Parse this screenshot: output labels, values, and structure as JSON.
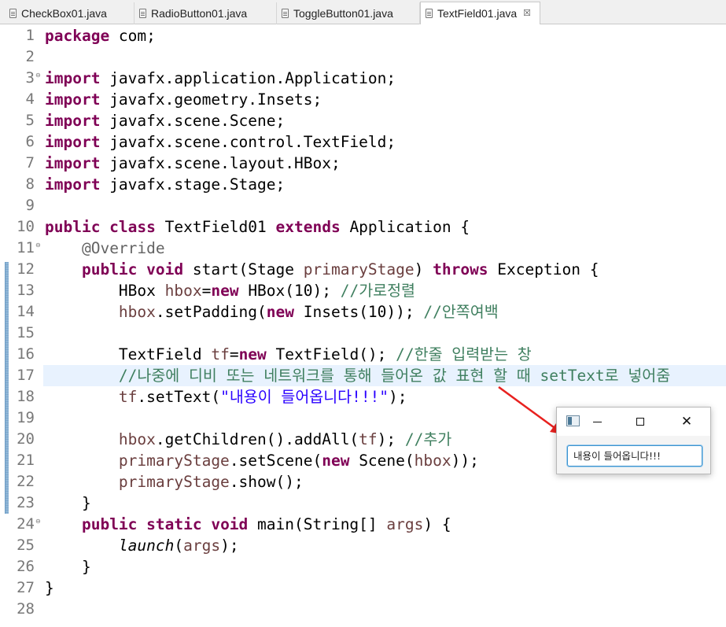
{
  "tabs": [
    {
      "label": "CheckBox01.java"
    },
    {
      "label": "RadioButton01.java"
    },
    {
      "label": "ToggleButton01.java"
    },
    {
      "label": "TextField01.java",
      "close": "☒"
    }
  ],
  "lines": [
    {
      "n": "1"
    },
    {
      "n": "2"
    },
    {
      "n": "3"
    },
    {
      "n": "4"
    },
    {
      "n": "5"
    },
    {
      "n": "6"
    },
    {
      "n": "7"
    },
    {
      "n": "8"
    },
    {
      "n": "9"
    },
    {
      "n": "10"
    },
    {
      "n": "11"
    },
    {
      "n": "12"
    },
    {
      "n": "13"
    },
    {
      "n": "14"
    },
    {
      "n": "15"
    },
    {
      "n": "16"
    },
    {
      "n": "17"
    },
    {
      "n": "18"
    },
    {
      "n": "19"
    },
    {
      "n": "20"
    },
    {
      "n": "21"
    },
    {
      "n": "22"
    },
    {
      "n": "23"
    },
    {
      "n": "24"
    },
    {
      "n": "25"
    },
    {
      "n": "26"
    },
    {
      "n": "27"
    },
    {
      "n": "28"
    }
  ],
  "code": {
    "l1": {
      "kw": "package",
      "rest": " com;"
    },
    "l3": {
      "kw": "import",
      "rest": " javafx.application.Application;"
    },
    "l4": {
      "kw": "import",
      "rest": " javafx.geometry.Insets;"
    },
    "l5": {
      "kw": "import",
      "rest": " javafx.scene.Scene;"
    },
    "l6": {
      "kw": "import",
      "rest": " javafx.scene.control.TextField;"
    },
    "l7": {
      "kw": "import",
      "rest": " javafx.scene.layout.HBox;"
    },
    "l8": {
      "kw": "import",
      "rest": " javafx.stage.Stage;"
    },
    "l10": {
      "kw1": "public class",
      "name": " TextField01 ",
      "kw2": "extends",
      "rest": " Application {"
    },
    "l11": {
      "indent": "    ",
      "ann": "@Override"
    },
    "l12": {
      "indent": "    ",
      "kw1": "public void",
      "a": " start(Stage ",
      "var": "primaryStage",
      "b": ") ",
      "kw2": "throws",
      "c": " Exception {"
    },
    "l13": {
      "indent": "        ",
      "a": "HBox ",
      "var": "hbox",
      "b": "=",
      "kw": "new",
      "c": " HBox(10); ",
      "com": "//가로정렬"
    },
    "l14": {
      "indent": "        ",
      "var": "hbox",
      "a": ".setPadding(",
      "kw": "new",
      "b": " Insets(10)); ",
      "com": "//안쪽여백"
    },
    "l16": {
      "indent": "        ",
      "a": "TextField ",
      "var": "tf",
      "b": "=",
      "kw": "new",
      "c": " TextField(); ",
      "com": "//한줄 입력받는 창"
    },
    "l17": {
      "indent": "        ",
      "com_a": "//나중에 디비 또는 네트워크를 통해 들어온 값 표현 할 때 ",
      "com_mono": "setText",
      "com_b": "로 넣어줌"
    },
    "l18": {
      "indent": "        ",
      "var": "tf",
      "a": ".setText(",
      "str": "\"내용이 들어옵니다!!!\"",
      "b": ");"
    },
    "l20": {
      "indent": "        ",
      "var": "hbox",
      "a": ".getChildren().addAll(",
      "var2": "tf",
      "b": "); ",
      "com": "//추가"
    },
    "l21": {
      "indent": "        ",
      "var": "primaryStage",
      "a": ".setScene(",
      "kw": "new",
      "b": " Scene(",
      "var2": "hbox",
      "c": "));"
    },
    "l22": {
      "indent": "        ",
      "var": "primaryStage",
      "a": ".show();"
    },
    "l23": {
      "text": "    }"
    },
    "l24": {
      "indent": "    ",
      "kw1": "public static void",
      "a": " main(String[] ",
      "var": "args",
      "b": ") {"
    },
    "l25": {
      "indent": "        ",
      "ital": "launch",
      "a": "(",
      "var": "args",
      "b": ");"
    },
    "l26": {
      "text": "    }"
    },
    "l27": {
      "text": "}"
    }
  },
  "popup": {
    "textfield_value": "내용이 들어옵니다!!!",
    "close_glyph": "✕"
  },
  "colors": {
    "keyword": "#7f0055",
    "comment": "#3f7f5f",
    "string": "#2a00ff",
    "variable": "#6a3e3e",
    "arrow": "#e8211f"
  }
}
